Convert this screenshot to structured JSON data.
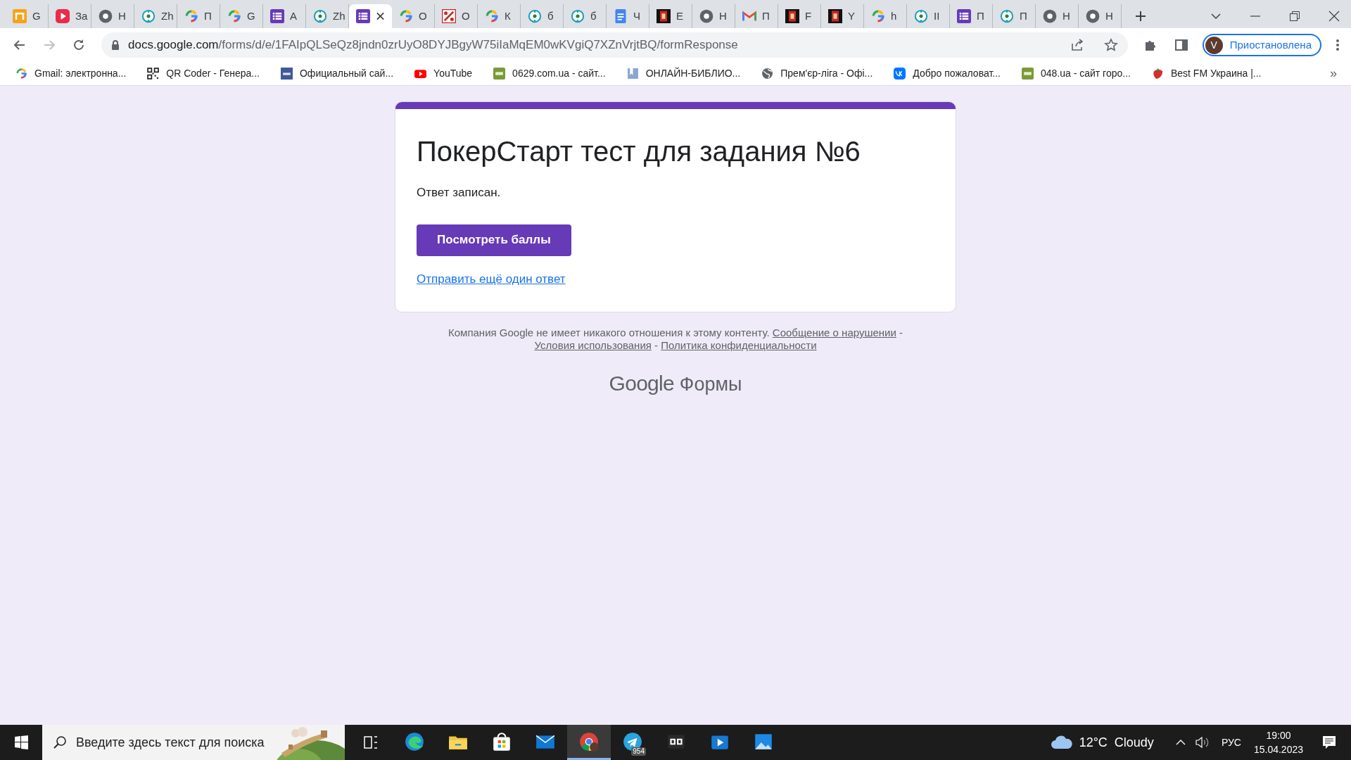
{
  "tabs": [
    {
      "title": "G",
      "kind": "bars",
      "selected": false
    },
    {
      "title": "За",
      "kind": "play",
      "selected": false
    },
    {
      "title": "Н",
      "kind": "chrome",
      "selected": false
    },
    {
      "title": "Zh",
      "kind": "compass",
      "selected": false
    },
    {
      "title": "П",
      "kind": "google",
      "selected": false
    },
    {
      "title": "G",
      "kind": "google",
      "selected": false
    },
    {
      "title": "А",
      "kind": "forms",
      "selected": false
    },
    {
      "title": "Zh",
      "kind": "compass",
      "selected": false
    },
    {
      "kind": "forms",
      "selected": true
    },
    {
      "title": "О",
      "kind": "google",
      "selected": false
    },
    {
      "title": "О",
      "kind": "percent",
      "selected": false
    },
    {
      "title": "К",
      "kind": "google",
      "selected": false
    },
    {
      "title": "б",
      "kind": "compass",
      "selected": false
    },
    {
      "title": "б",
      "kind": "compass",
      "selected": false
    },
    {
      "title": "Ч",
      "kind": "docs",
      "selected": false
    },
    {
      "title": "Е",
      "kind": "yo",
      "selected": false
    },
    {
      "title": "Н",
      "kind": "chrome",
      "selected": false
    },
    {
      "title": "П",
      "kind": "gmail",
      "selected": false
    },
    {
      "title": "F",
      "kind": "yo",
      "selected": false
    },
    {
      "title": "Y",
      "kind": "yo",
      "selected": false
    },
    {
      "title": "h",
      "kind": "google",
      "selected": false
    },
    {
      "title": "II",
      "kind": "compass",
      "selected": false
    },
    {
      "title": "П",
      "kind": "forms",
      "selected": false
    },
    {
      "title": "П",
      "kind": "compass",
      "selected": false
    },
    {
      "title": "Н",
      "kind": "chrome",
      "selected": false
    },
    {
      "title": "Н",
      "kind": "chrome",
      "selected": false
    }
  ],
  "address_bar": {
    "host": "docs.google.com",
    "path": "/forms/d/e/1FAIpQLSeQz8jndn0zrUyO8DYJBgyW75iIaMqEM0wKVgiQ7XZnVrjtBQ/formResponse"
  },
  "profile": {
    "initial": "V",
    "status": "Приостановлена"
  },
  "bookmarks": [
    {
      "label": "Gmail: электронна...",
      "kind": "google"
    },
    {
      "label": "QR Coder - Генера...",
      "kind": "qr"
    },
    {
      "label": "Официальный сай...",
      "kind": "jw"
    },
    {
      "label": "YouTube",
      "kind": "youtube"
    },
    {
      "label": "0629.com.ua - сайт...",
      "kind": "green"
    },
    {
      "label": "ОНЛАЙН-БИБЛИО...",
      "kind": "book"
    },
    {
      "label": "Прем'єр-ліга - Офі...",
      "kind": "globe"
    },
    {
      "label": "Добро пожаловат...",
      "kind": "vk"
    },
    {
      "label": "048.ua - сайт горо...",
      "kind": "green"
    },
    {
      "label": "Best FM Украина |...",
      "kind": "berry"
    }
  ],
  "bookmarks_overflow": "»",
  "form": {
    "title": "ПокерСтарт тест для задания №6",
    "message": "Ответ записан.",
    "button": "Посмотреть баллы",
    "link": "Отправить ещё один ответ"
  },
  "footer": {
    "parts": [
      {
        "kind": "text",
        "text": "Компания Google не имеет никакого отношения к этому контенту."
      },
      {
        "kind": "link",
        "text": "Сообщение о нарушении"
      },
      {
        "kind": "text",
        "text": "-"
      },
      {
        "kind": "link",
        "text": "Условия использования"
      },
      {
        "kind": "text",
        "text": "-"
      },
      {
        "kind": "link",
        "text": "Политика конфиденциальности"
      }
    ],
    "brand": "Google",
    "product": "Формы"
  },
  "taskbar": {
    "search_placeholder": "Введите здесь текст для поиска",
    "apps": [
      {
        "kind": "edge",
        "active": false
      },
      {
        "kind": "folder",
        "active": false
      },
      {
        "kind": "store",
        "active": false
      },
      {
        "kind": "mail",
        "active": false
      },
      {
        "kind": "chrome",
        "active": true
      },
      {
        "kind": "telegram",
        "active": false,
        "badge": "954"
      },
      {
        "kind": "gg",
        "active": false
      },
      {
        "kind": "media",
        "active": false
      },
      {
        "kind": "photos",
        "active": false
      }
    ],
    "temperature": "12°C",
    "weather": "Cloudy",
    "language": "РУС",
    "time": "19:00",
    "date": "15.04.2023"
  }
}
